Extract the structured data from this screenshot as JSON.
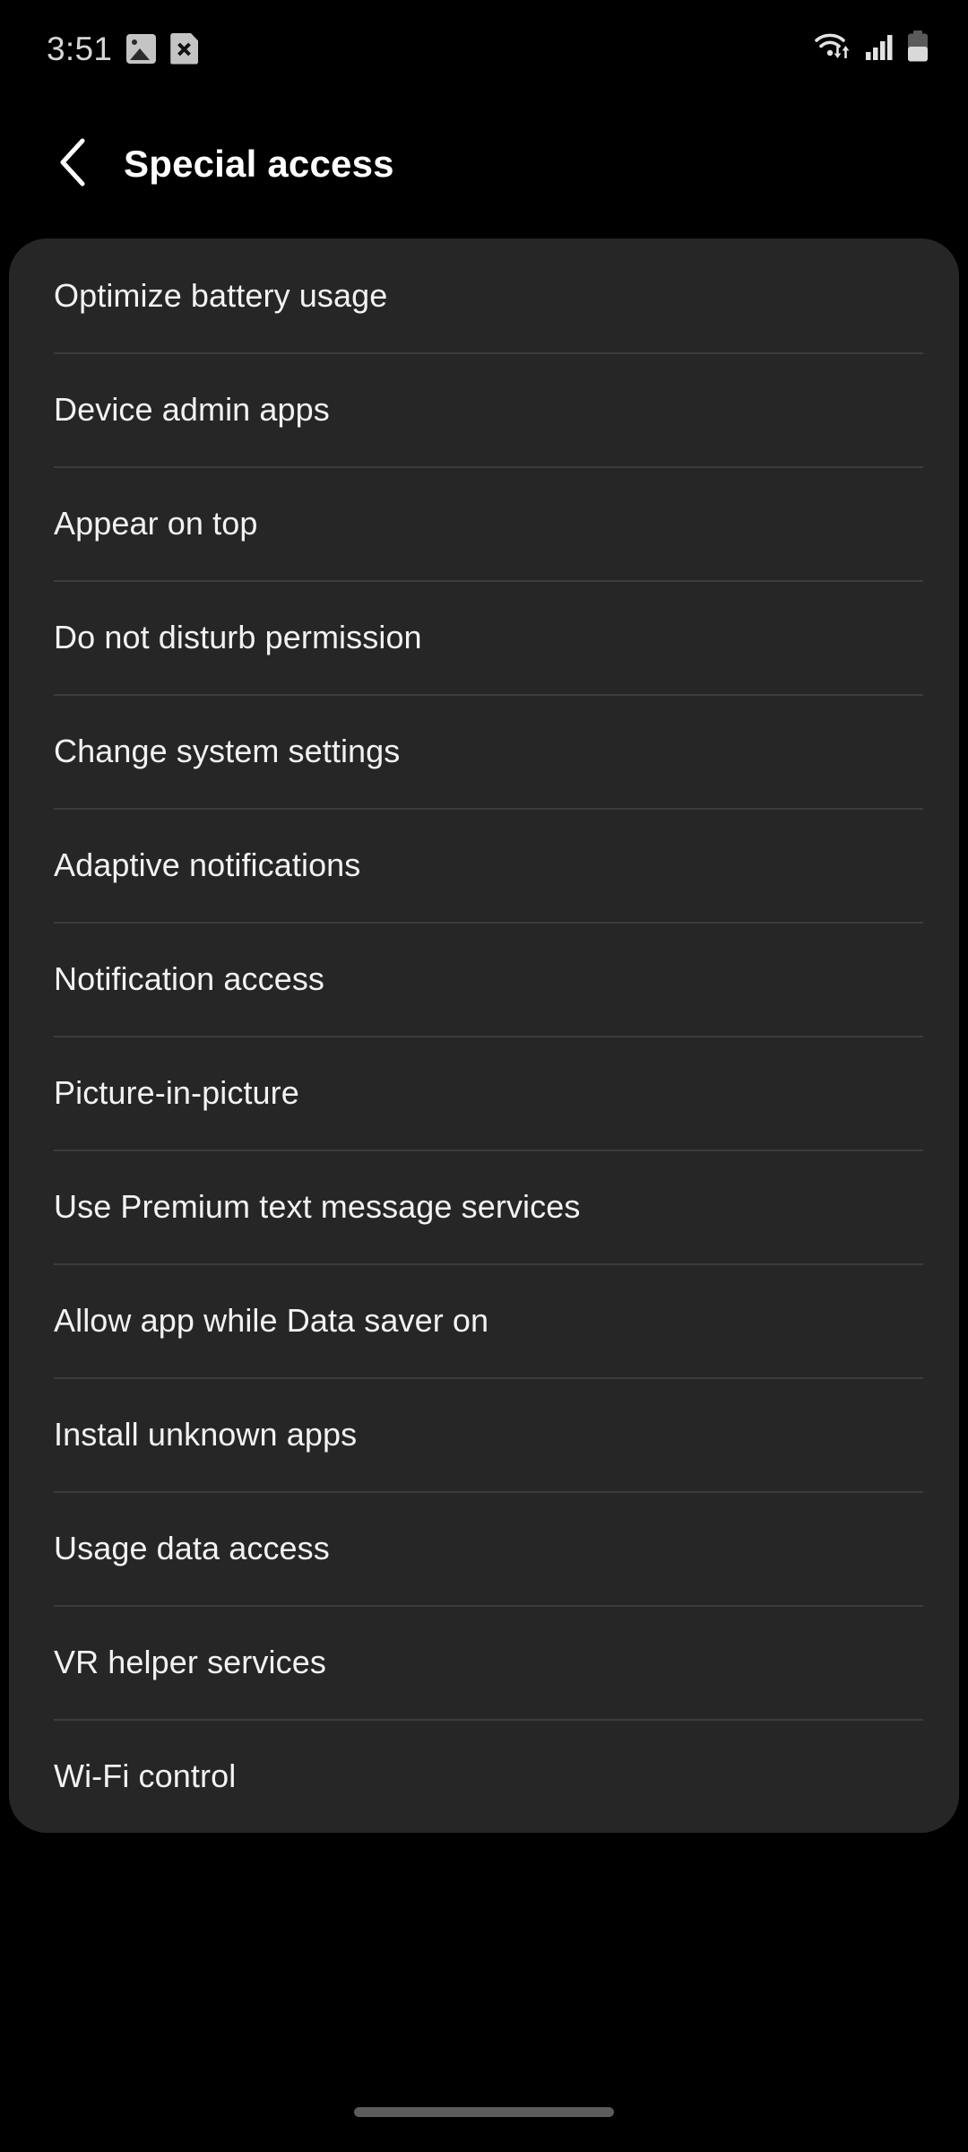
{
  "status_bar": {
    "time": "3:51",
    "left_icons": [
      {
        "name": "image-icon"
      },
      {
        "name": "file-error-icon"
      }
    ],
    "right_icons": [
      {
        "name": "wifi-icon"
      },
      {
        "name": "cellular-signal-icon"
      },
      {
        "name": "battery-icon"
      }
    ]
  },
  "header": {
    "back_icon": "back-chevron-icon",
    "title": "Special access"
  },
  "settings_list": {
    "items": [
      {
        "label": "Optimize battery usage"
      },
      {
        "label": "Device admin apps"
      },
      {
        "label": "Appear on top"
      },
      {
        "label": "Do not disturb permission"
      },
      {
        "label": "Change system settings"
      },
      {
        "label": "Adaptive notifications"
      },
      {
        "label": "Notification access"
      },
      {
        "label": "Picture-in-picture"
      },
      {
        "label": "Use Premium text message services"
      },
      {
        "label": "Allow app while Data saver on"
      },
      {
        "label": "Install unknown apps"
      },
      {
        "label": "Usage data access"
      },
      {
        "label": "VR helper services"
      },
      {
        "label": "Wi-Fi control"
      }
    ]
  },
  "nav_bar": {
    "handle": "gesture-handle"
  },
  "colors": {
    "background": "#000000",
    "card": "#262626",
    "divider": "#3c3c3c",
    "text_primary": "#f2f2f2",
    "status_text": "#d6d6d6",
    "handle": "#5c5c5c"
  }
}
